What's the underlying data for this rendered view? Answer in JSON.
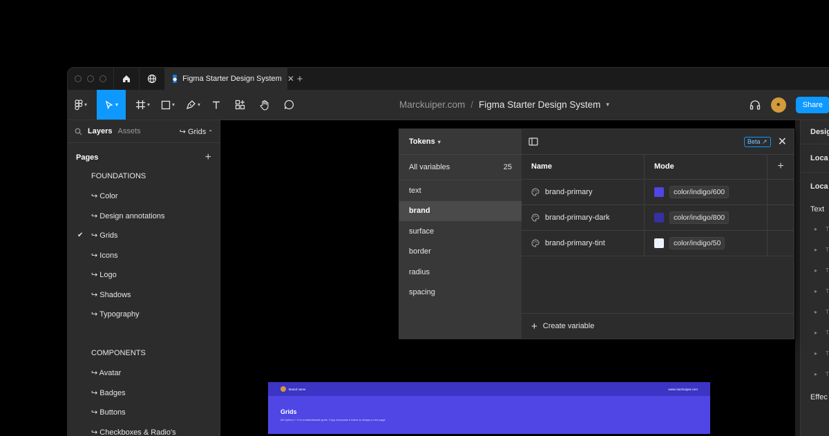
{
  "tab": {
    "title": "Figma Starter Design System"
  },
  "breadcrumb": {
    "owner": "Marckuiper.com",
    "separator": "/",
    "file": "Figma Starter Design System"
  },
  "share_label": "Share",
  "left_panel": {
    "tabs": [
      "Layers",
      "Assets"
    ],
    "current_page": "↪ Grids",
    "pages_label": "Pages",
    "foundations": [
      "FOUNDATIONS",
      "↪ Color",
      "↪ Design annotations",
      "↪ Grids",
      "↪ Icons",
      "↪ Logo",
      "↪ Shadows",
      "↪ Typography"
    ],
    "components": [
      "COMPONENTS",
      "↪ Avatar",
      "↪ Badges",
      "↪ Buttons",
      "↪ Checkboxes & Radio's"
    ],
    "checked_item": "↪ Grids"
  },
  "right_panel": {
    "rows": [
      "Desig",
      "Loca",
      "Loca",
      "Text",
      "Effec"
    ]
  },
  "variables": {
    "collection": "Tokens",
    "all_label": "All variables",
    "all_count": "25",
    "groups": [
      "text",
      "brand",
      "surface",
      "border",
      "radius",
      "spacing"
    ],
    "selected_group": "brand",
    "beta_label": "Beta",
    "columns": {
      "name": "Name",
      "mode": "Mode"
    },
    "rows": [
      {
        "name": "brand-primary",
        "value": "color/indigo/600",
        "color": "#4f46e5"
      },
      {
        "name": "brand-primary-dark",
        "value": "color/indigo/800",
        "color": "#3730a3"
      },
      {
        "name": "brand-primary-tint",
        "value": "color/indigo/50",
        "color": "#eef2ff"
      }
    ],
    "create_label": "Create variable"
  },
  "frame": {
    "brand": "Brand name",
    "url": "www.marckuiper.com",
    "title": "Grids",
    "description": "Alt Option) + G to enable/disable grids. Copy and paste a frame to design a new page"
  },
  "colors": {
    "accent": "#0d99ff",
    "indigo": "#4f46e5"
  }
}
